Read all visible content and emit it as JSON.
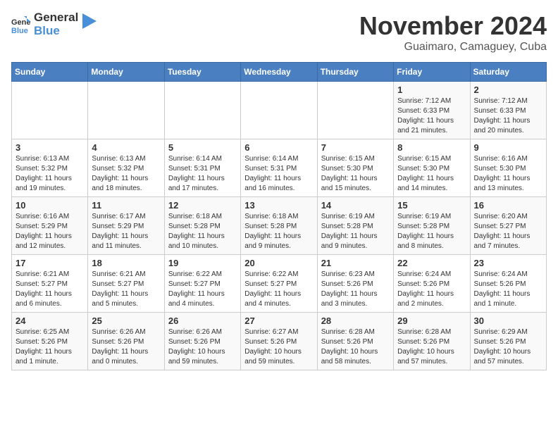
{
  "logo": {
    "general": "General",
    "blue": "Blue"
  },
  "title": "November 2024",
  "subtitle": "Guaimaro, Camaguey, Cuba",
  "days_of_week": [
    "Sunday",
    "Monday",
    "Tuesday",
    "Wednesday",
    "Thursday",
    "Friday",
    "Saturday"
  ],
  "weeks": [
    [
      {
        "day": "",
        "info": ""
      },
      {
        "day": "",
        "info": ""
      },
      {
        "day": "",
        "info": ""
      },
      {
        "day": "",
        "info": ""
      },
      {
        "day": "",
        "info": ""
      },
      {
        "day": "1",
        "info": "Sunrise: 7:12 AM\nSunset: 6:33 PM\nDaylight: 11 hours and 21 minutes."
      },
      {
        "day": "2",
        "info": "Sunrise: 7:12 AM\nSunset: 6:33 PM\nDaylight: 11 hours and 20 minutes."
      }
    ],
    [
      {
        "day": "3",
        "info": "Sunrise: 6:13 AM\nSunset: 5:32 PM\nDaylight: 11 hours and 19 minutes."
      },
      {
        "day": "4",
        "info": "Sunrise: 6:13 AM\nSunset: 5:32 PM\nDaylight: 11 hours and 18 minutes."
      },
      {
        "day": "5",
        "info": "Sunrise: 6:14 AM\nSunset: 5:31 PM\nDaylight: 11 hours and 17 minutes."
      },
      {
        "day": "6",
        "info": "Sunrise: 6:14 AM\nSunset: 5:31 PM\nDaylight: 11 hours and 16 minutes."
      },
      {
        "day": "7",
        "info": "Sunrise: 6:15 AM\nSunset: 5:30 PM\nDaylight: 11 hours and 15 minutes."
      },
      {
        "day": "8",
        "info": "Sunrise: 6:15 AM\nSunset: 5:30 PM\nDaylight: 11 hours and 14 minutes."
      },
      {
        "day": "9",
        "info": "Sunrise: 6:16 AM\nSunset: 5:30 PM\nDaylight: 11 hours and 13 minutes."
      }
    ],
    [
      {
        "day": "10",
        "info": "Sunrise: 6:16 AM\nSunset: 5:29 PM\nDaylight: 11 hours and 12 minutes."
      },
      {
        "day": "11",
        "info": "Sunrise: 6:17 AM\nSunset: 5:29 PM\nDaylight: 11 hours and 11 minutes."
      },
      {
        "day": "12",
        "info": "Sunrise: 6:18 AM\nSunset: 5:28 PM\nDaylight: 11 hours and 10 minutes."
      },
      {
        "day": "13",
        "info": "Sunrise: 6:18 AM\nSunset: 5:28 PM\nDaylight: 11 hours and 9 minutes."
      },
      {
        "day": "14",
        "info": "Sunrise: 6:19 AM\nSunset: 5:28 PM\nDaylight: 11 hours and 9 minutes."
      },
      {
        "day": "15",
        "info": "Sunrise: 6:19 AM\nSunset: 5:28 PM\nDaylight: 11 hours and 8 minutes."
      },
      {
        "day": "16",
        "info": "Sunrise: 6:20 AM\nSunset: 5:27 PM\nDaylight: 11 hours and 7 minutes."
      }
    ],
    [
      {
        "day": "17",
        "info": "Sunrise: 6:21 AM\nSunset: 5:27 PM\nDaylight: 11 hours and 6 minutes."
      },
      {
        "day": "18",
        "info": "Sunrise: 6:21 AM\nSunset: 5:27 PM\nDaylight: 11 hours and 5 minutes."
      },
      {
        "day": "19",
        "info": "Sunrise: 6:22 AM\nSunset: 5:27 PM\nDaylight: 11 hours and 4 minutes."
      },
      {
        "day": "20",
        "info": "Sunrise: 6:22 AM\nSunset: 5:27 PM\nDaylight: 11 hours and 4 minutes."
      },
      {
        "day": "21",
        "info": "Sunrise: 6:23 AM\nSunset: 5:26 PM\nDaylight: 11 hours and 3 minutes."
      },
      {
        "day": "22",
        "info": "Sunrise: 6:24 AM\nSunset: 5:26 PM\nDaylight: 11 hours and 2 minutes."
      },
      {
        "day": "23",
        "info": "Sunrise: 6:24 AM\nSunset: 5:26 PM\nDaylight: 11 hours and 1 minute."
      }
    ],
    [
      {
        "day": "24",
        "info": "Sunrise: 6:25 AM\nSunset: 5:26 PM\nDaylight: 11 hours and 1 minute."
      },
      {
        "day": "25",
        "info": "Sunrise: 6:26 AM\nSunset: 5:26 PM\nDaylight: 11 hours and 0 minutes."
      },
      {
        "day": "26",
        "info": "Sunrise: 6:26 AM\nSunset: 5:26 PM\nDaylight: 10 hours and 59 minutes."
      },
      {
        "day": "27",
        "info": "Sunrise: 6:27 AM\nSunset: 5:26 PM\nDaylight: 10 hours and 59 minutes."
      },
      {
        "day": "28",
        "info": "Sunrise: 6:28 AM\nSunset: 5:26 PM\nDaylight: 10 hours and 58 minutes."
      },
      {
        "day": "29",
        "info": "Sunrise: 6:28 AM\nSunset: 5:26 PM\nDaylight: 10 hours and 57 minutes."
      },
      {
        "day": "30",
        "info": "Sunrise: 6:29 AM\nSunset: 5:26 PM\nDaylight: 10 hours and 57 minutes."
      }
    ]
  ]
}
